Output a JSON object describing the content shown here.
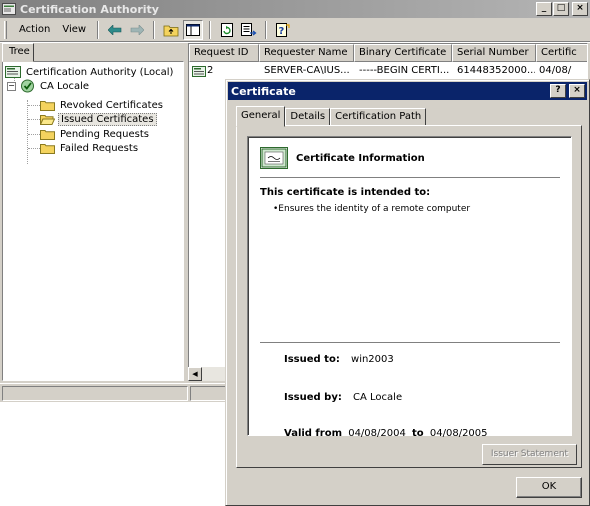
{
  "main_window": {
    "title": "Certification Authority",
    "caption_buttons": [
      "_",
      "□",
      "×"
    ],
    "menu": {
      "action_label": "Action",
      "view_label": "View"
    },
    "toolbar_icons": [
      "back-arrow-icon",
      "forward-arrow-icon",
      "up-folder-icon",
      "show-tree-icon",
      "refresh-icon",
      "export-list-icon",
      "help-icon"
    ]
  },
  "tree": {
    "tab_label": "Tree",
    "root_label": "Certification Authority (Local)",
    "ca_label": "CA Locale",
    "expander_symbol": "−",
    "folders": [
      {
        "label": "Revoked Certificates"
      },
      {
        "label": "Issued Certificates"
      },
      {
        "label": "Pending Requests"
      },
      {
        "label": "Failed Requests"
      }
    ]
  },
  "list": {
    "columns": [
      "Request ID",
      "Requester Name",
      "Binary Certificate",
      "Serial Number",
      "Certific"
    ],
    "rows": [
      {
        "request_id": "2",
        "requester": "SERVER-CA\\IUS...",
        "binary": "-----BEGIN CERTI...",
        "serial": "61448352000...",
        "date": "04/08/"
      }
    ]
  },
  "dialog": {
    "title": "Certificate",
    "help_button": "?",
    "close_button": "×",
    "tabs": [
      "General",
      "Details",
      "Certification Path"
    ],
    "heading": "Certificate Information",
    "intended_label": "This certificate is intended to:",
    "purpose": "•Ensures the identity of a remote computer",
    "issued_to_label": "Issued to:",
    "issued_to_value": "win2003",
    "issued_by_label": "Issued by:",
    "issued_by_value": "CA Locale",
    "valid_from_label": "Valid from",
    "valid_from_value": "04/08/2004",
    "valid_to_label": "to",
    "valid_to_value": "04/08/2005",
    "issuer_statement_button": "Issuer Statement",
    "ok_button": "OK"
  },
  "colors": {
    "title_active": "#0a246a",
    "title_inactive": "#808080",
    "face": "#d4d0c8",
    "folder": "#f4d35e"
  }
}
